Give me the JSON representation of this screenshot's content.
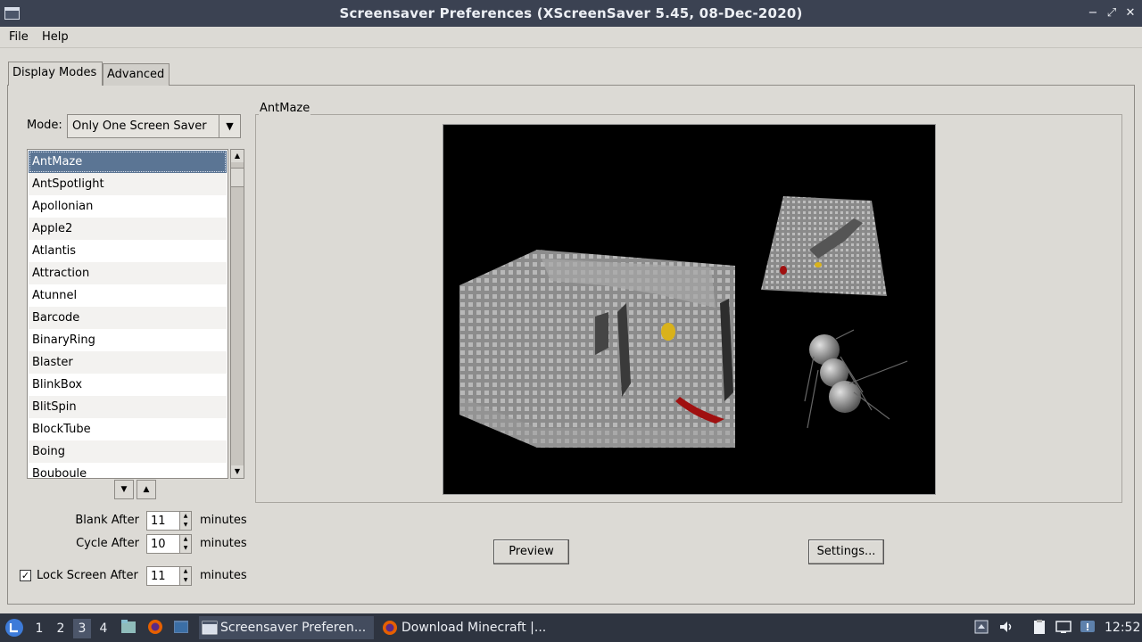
{
  "window": {
    "title": "Screensaver Preferences  (XScreenSaver 5.45, 08-Dec-2020)",
    "minimize": "−",
    "maximize": "⤢",
    "close": "✕"
  },
  "menu": {
    "file": "File",
    "help": "Help"
  },
  "tabs": {
    "display_modes": "Display Modes",
    "advanced": "Advanced"
  },
  "mode": {
    "label": "Mode:",
    "value": "Only One Screen Saver"
  },
  "savers": {
    "items": [
      "AntMaze",
      "AntSpotlight",
      "Apollonian",
      "Apple2",
      "Atlantis",
      "Attraction",
      "Atunnel",
      "Barcode",
      "BinaryRing",
      "Blaster",
      "BlinkBox",
      "BlitSpin",
      "BlockTube",
      "Boing",
      "Bouboule"
    ],
    "selected": "AntMaze"
  },
  "timing": {
    "blank_label": "Blank After",
    "blank_value": "11",
    "cycle_label": "Cycle After",
    "cycle_value": "10",
    "lock_label": "Lock Screen After",
    "lock_value": "11",
    "lock_checked": "✓",
    "unit": "minutes"
  },
  "preview_frame": {
    "label": "AntMaze"
  },
  "buttons": {
    "preview": "Preview",
    "settings": "Settings..."
  },
  "taskbar": {
    "workspaces": [
      "1",
      "2",
      "3",
      "4"
    ],
    "active_workspace": "3",
    "tasks": [
      {
        "label": "Screensaver Preferen...",
        "icon": "window-icon"
      },
      {
        "label": "Download Minecraft |...",
        "icon": "firefox-icon"
      }
    ],
    "clock": "12:52"
  },
  "colors": {
    "titlebar": "#3b4252",
    "taskbar": "#2e3440",
    "selection": "#5b7594",
    "background": "#dcdad5"
  }
}
